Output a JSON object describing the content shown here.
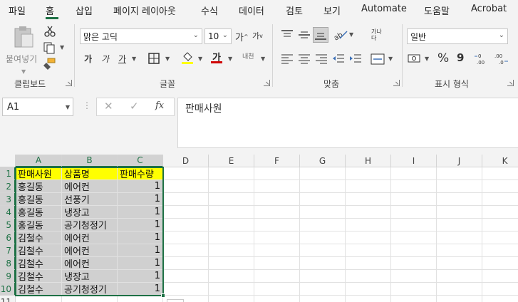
{
  "menu": {
    "tabs": [
      "파일",
      "홈",
      "삽입",
      "페이지 레이아웃",
      "수식",
      "데이터",
      "검토",
      "보기",
      "Automate",
      "도움말",
      "Acrobat"
    ],
    "active": "홈"
  },
  "ribbon": {
    "clipboard": {
      "paste_label": "붙여넣기",
      "group_label": "클립보드"
    },
    "font": {
      "font_name": "맑은 고딕",
      "font_size": "10",
      "bold": "가",
      "italic": "가",
      "underline": "가",
      "increase": "가",
      "decrease": "가",
      "phonetic": "내천",
      "group_label": "글꼴"
    },
    "alignment": {
      "wrap": "가나다",
      "group_label": "맞춤"
    },
    "number": {
      "format": "일반",
      "percent": "%",
      "comma": "9",
      "group_label": "표시 형식"
    }
  },
  "formula_bar": {
    "name_box": "A1",
    "fx": "fx",
    "content": "판매사원"
  },
  "grid": {
    "columns": [
      "A",
      "B",
      "C",
      "D",
      "E",
      "F",
      "G",
      "H",
      "I",
      "J",
      "K"
    ],
    "rows": [
      "1",
      "2",
      "3",
      "4",
      "5",
      "6",
      "7",
      "8",
      "9",
      "10",
      "11"
    ],
    "header": [
      "판매사원",
      "상품명",
      "판매수량"
    ],
    "data": [
      [
        "홍길동",
        "에어컨",
        "1"
      ],
      [
        "홍길동",
        "선풍기",
        "1"
      ],
      [
        "홍길동",
        "냉장고",
        "1"
      ],
      [
        "홍길동",
        "공기청정기",
        "1"
      ],
      [
        "김철수",
        "에어컨",
        "1"
      ],
      [
        "김철수",
        "에어컨",
        "1"
      ],
      [
        "김철수",
        "에어컨",
        "1"
      ],
      [
        "김철수",
        "냉장고",
        "1"
      ],
      [
        "김철수",
        "공기청정기",
        "1"
      ]
    ]
  },
  "colors": {
    "accent": "#1e7145",
    "header_fill": "#ffff00",
    "body_fill": "#d0d0d0"
  }
}
